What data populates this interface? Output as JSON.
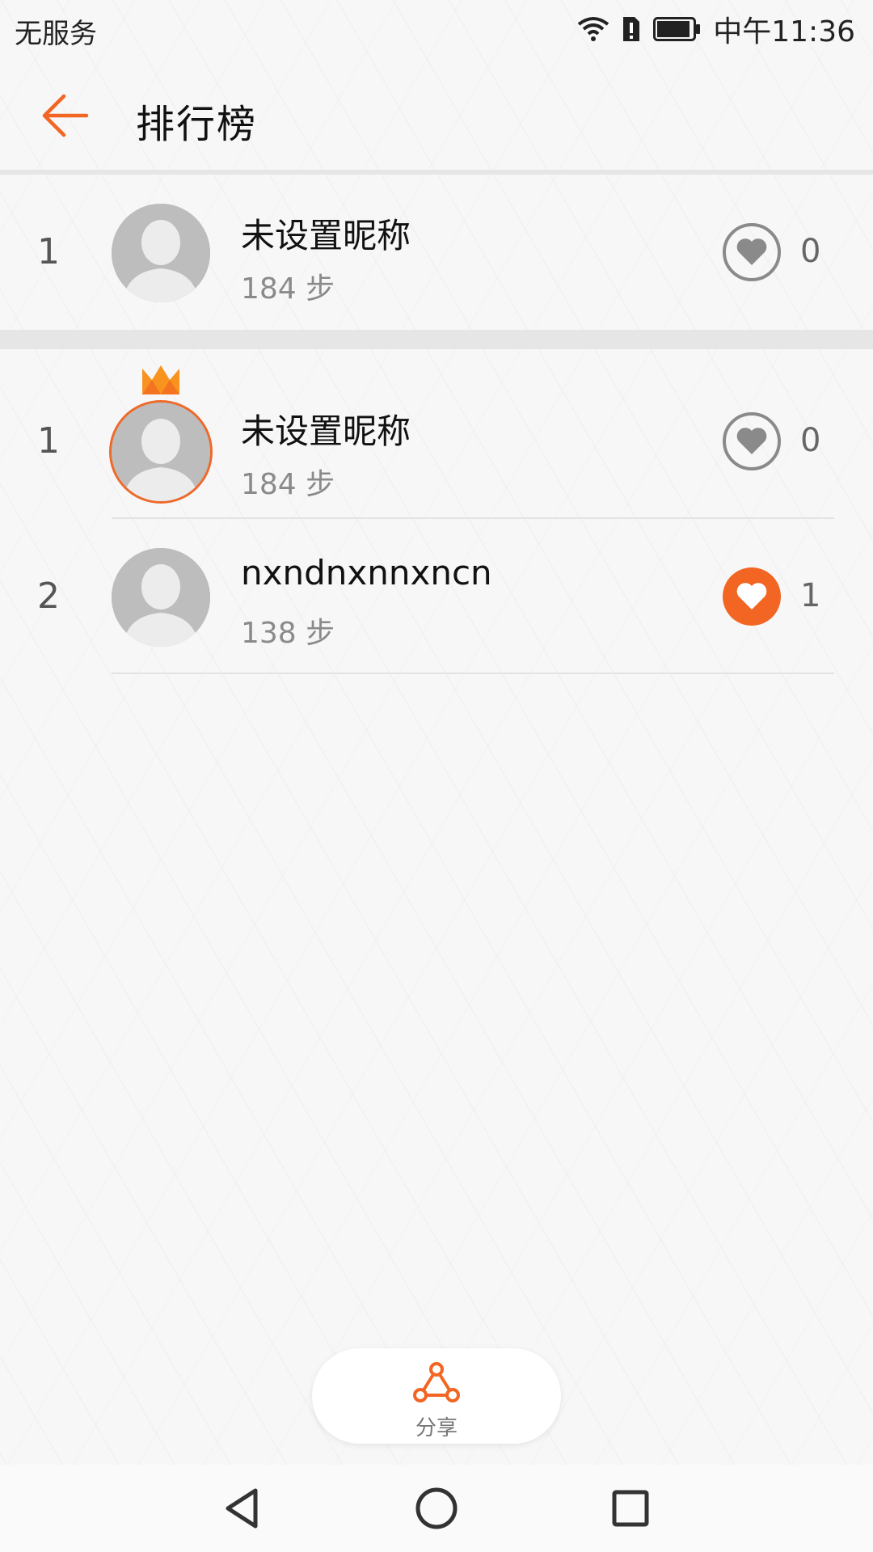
{
  "status_bar": {
    "carrier": "无服务",
    "time": "中午11:36",
    "icons": [
      "wifi-icon",
      "sim-alert-icon",
      "battery-icon"
    ]
  },
  "header": {
    "title": "排行榜",
    "back_icon": "back-arrow-icon"
  },
  "accent_color": "#f26522",
  "my_rank": {
    "rank": "1",
    "name": "未设置昵称",
    "steps": "184 步",
    "likes": "0",
    "liked": false
  },
  "ranking": [
    {
      "rank": "1",
      "name": "未设置昵称",
      "steps": "184 步",
      "likes": "0",
      "liked": false,
      "crown": true
    },
    {
      "rank": "2",
      "name": "nxndnxnnxncn",
      "steps": "138 步",
      "likes": "1",
      "liked": true,
      "crown": false
    }
  ],
  "share": {
    "label": "分享",
    "icon": "share-icon"
  },
  "nav": [
    "back-triangle-icon",
    "home-circle-icon",
    "recents-square-icon"
  ]
}
